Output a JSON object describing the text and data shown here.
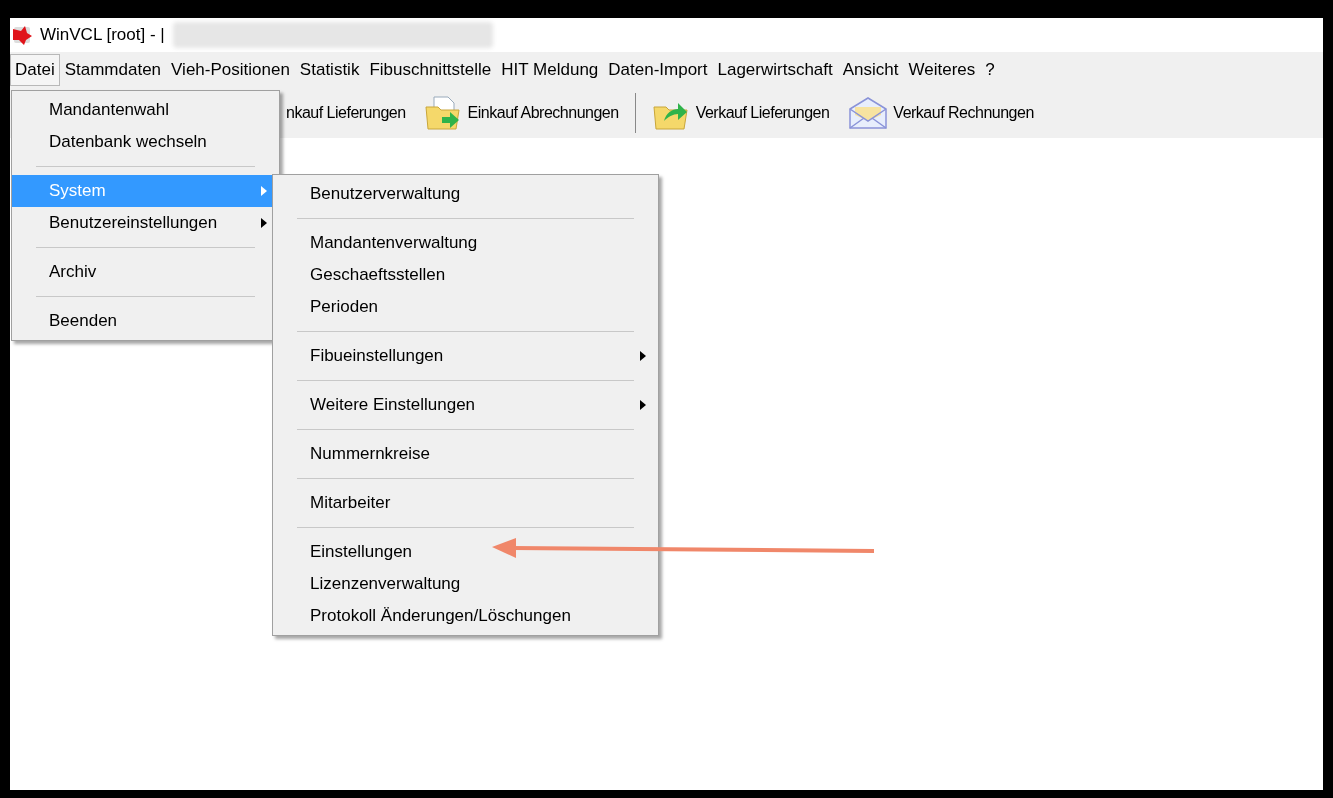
{
  "window": {
    "title": "WinVCL [root] - |"
  },
  "menubar": [
    {
      "label": "Datei",
      "selected": true
    },
    {
      "label": "Stammdaten",
      "selected": false
    },
    {
      "label": "Vieh-Positionen",
      "selected": false
    },
    {
      "label": "Statistik",
      "selected": false
    },
    {
      "label": "Fibuschnittstelle",
      "selected": false
    },
    {
      "label": "HIT Meldung",
      "selected": false
    },
    {
      "label": "Daten-Import",
      "selected": false
    },
    {
      "label": "Lagerwirtschaft",
      "selected": false
    },
    {
      "label": "Ansicht",
      "selected": false
    },
    {
      "label": "Weiteres",
      "selected": false
    },
    {
      "label": "?",
      "selected": false
    }
  ],
  "toolbar": [
    {
      "kind": "plain",
      "label": "nkauf Lieferungen"
    },
    {
      "kind": "import",
      "label": "Einkauf Abrechnungen"
    },
    {
      "kind": "separator"
    },
    {
      "kind": "export",
      "label": "Verkauf Lieferungen"
    },
    {
      "kind": "mail",
      "label": "Verkauf Rechnungen"
    }
  ],
  "file_menu": [
    {
      "kind": "item",
      "label": "Mandantenwahl",
      "submenu": false,
      "selected": false
    },
    {
      "kind": "item",
      "label": "Datenbank wechseln",
      "submenu": false,
      "selected": false
    },
    {
      "kind": "separator"
    },
    {
      "kind": "item",
      "label": "System",
      "submenu": true,
      "selected": true
    },
    {
      "kind": "item",
      "label": "Benutzereinstellungen",
      "submenu": true,
      "selected": false
    },
    {
      "kind": "separator"
    },
    {
      "kind": "item",
      "label": "Archiv",
      "submenu": false,
      "selected": false
    },
    {
      "kind": "separator"
    },
    {
      "kind": "item",
      "label": "Beenden",
      "submenu": false,
      "selected": false
    }
  ],
  "system_menu": [
    {
      "kind": "item",
      "label": "Benutzerverwaltung",
      "submenu": false,
      "selected": false
    },
    {
      "kind": "separator"
    },
    {
      "kind": "item",
      "label": "Mandantenverwaltung",
      "submenu": false,
      "selected": false
    },
    {
      "kind": "item",
      "label": "Geschaeftsstellen",
      "submenu": false,
      "selected": false
    },
    {
      "kind": "item",
      "label": "Perioden",
      "submenu": false,
      "selected": false
    },
    {
      "kind": "separator"
    },
    {
      "kind": "item",
      "label": "Fibueinstellungen",
      "submenu": true,
      "selected": false
    },
    {
      "kind": "separator"
    },
    {
      "kind": "item",
      "label": "Weitere Einstellungen",
      "submenu": true,
      "selected": false
    },
    {
      "kind": "separator"
    },
    {
      "kind": "item",
      "label": "Nummernkreise",
      "submenu": false,
      "selected": false
    },
    {
      "kind": "separator"
    },
    {
      "kind": "item",
      "label": "Mitarbeiter",
      "submenu": false,
      "selected": false
    },
    {
      "kind": "separator"
    },
    {
      "kind": "item",
      "label": "Einstellungen",
      "submenu": false,
      "selected": false
    },
    {
      "kind": "item",
      "label": "Lizenzenverwaltung",
      "submenu": false,
      "selected": false
    },
    {
      "kind": "item",
      "label": "Protokoll Änderungen/Löschungen",
      "submenu": false,
      "selected": false
    }
  ]
}
